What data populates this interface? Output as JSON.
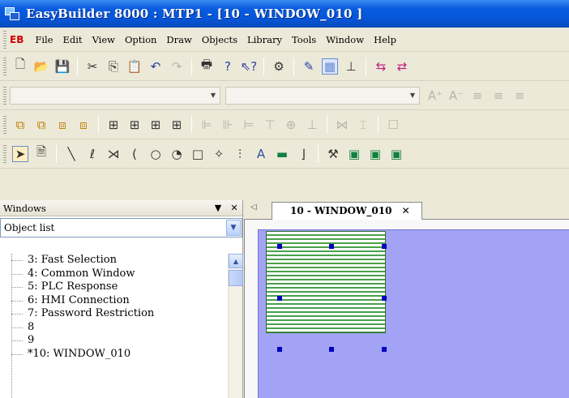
{
  "window": {
    "title": "EasyBuilder 8000 : MTP1 - [10 - WINDOW_010 ]"
  },
  "menubar": {
    "logo": "EB",
    "items": [
      {
        "label": "File"
      },
      {
        "label": "Edit"
      },
      {
        "label": "View"
      },
      {
        "label": "Option"
      },
      {
        "label": "Draw"
      },
      {
        "label": "Objects"
      },
      {
        "label": "Library"
      },
      {
        "label": "Tools"
      },
      {
        "label": "Window"
      },
      {
        "label": "Help"
      }
    ]
  },
  "format_bar": {
    "font_combo_value": "",
    "size_combo_value": ""
  },
  "panel": {
    "title": "Windows",
    "dropdown_value": "Object list",
    "tree_items": [
      "3: Fast Selection",
      "4: Common Window",
      "5: PLC Response",
      "6: HMI Connection",
      "7: Password Restriction",
      "8",
      "9",
      "*10: WINDOW_010"
    ]
  },
  "editor": {
    "active_tab": "10 - WINDOW_010"
  },
  "icons": {
    "panel_pin": "▼",
    "panel_close": "✕",
    "tab_close": "✕",
    "tab_scroll": "◁"
  },
  "colors": {
    "titlebar": "#0555d8",
    "canvas": "#a3a3f5",
    "shape_stripe": "#4aa04a",
    "handle": "#0000c0"
  }
}
